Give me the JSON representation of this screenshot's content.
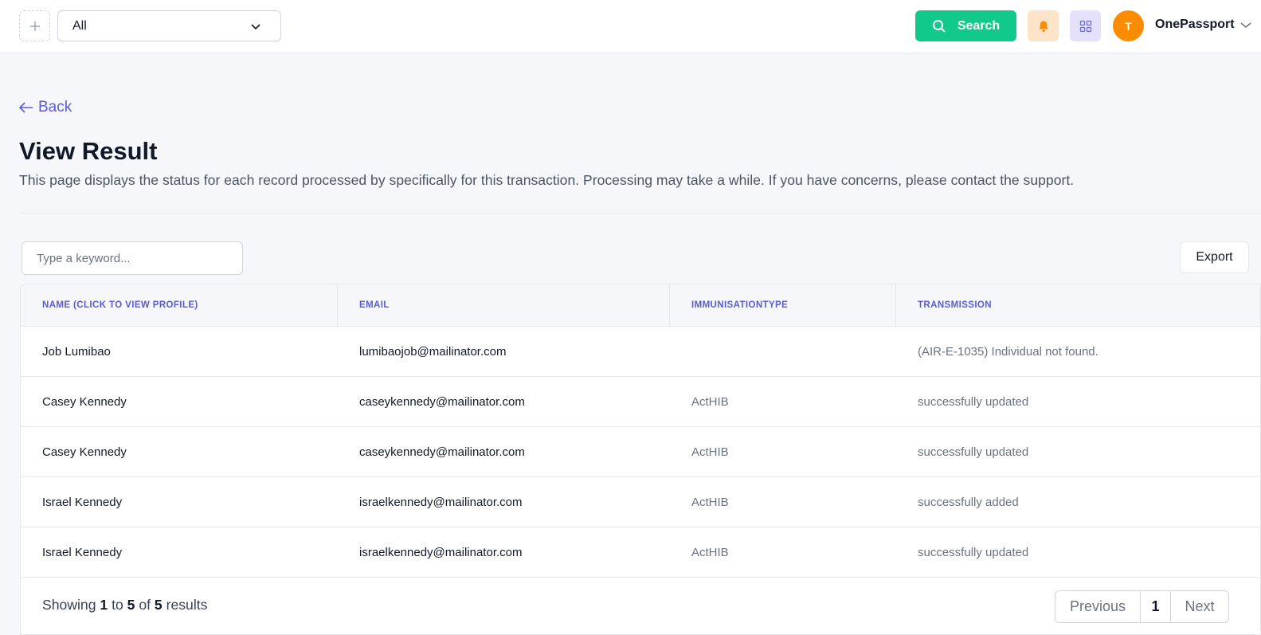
{
  "topbar": {
    "scope_value": "All",
    "search_label": "Search",
    "avatar_initial": "T",
    "user_name": "OnePassport"
  },
  "page": {
    "back_label": "Back",
    "title": "View Result",
    "description": "This page displays the status for each record processed by specifically for this transaction. Processing may take a while. If you have concerns, please contact the support."
  },
  "toolbar": {
    "keyword_placeholder": "Type a keyword...",
    "export_label": "Export"
  },
  "table": {
    "headers": [
      "NAME (CLICK TO VIEW PROFILE)",
      "EMAIL",
      "IMMUNISATIONTYPE",
      "TRANSMISSION"
    ],
    "rows": [
      [
        "Job Lumibao",
        "lumibaojob@mailinator.com",
        "",
        "(AIR-E-1035) Individual not found."
      ],
      [
        "Casey Kennedy",
        "caseykennedy@mailinator.com",
        "ActHIB",
        "successfully updated"
      ],
      [
        "Casey Kennedy",
        "caseykennedy@mailinator.com",
        "ActHIB",
        "successfully updated"
      ],
      [
        "Israel Kennedy",
        "israelkennedy@mailinator.com",
        "ActHIB",
        "successfully added"
      ],
      [
        "Israel Kennedy",
        "israelkennedy@mailinator.com",
        "ActHIB",
        "successfully updated"
      ]
    ]
  },
  "pagination": {
    "showing_prefix": "Showing",
    "from": "1",
    "to_word": "to",
    "to": "5",
    "of_word": "of",
    "total": "5",
    "results_word": "results",
    "previous_label": "Previous",
    "current_page": "1",
    "next_label": "Next"
  },
  "colors": {
    "accent": "#5b5bd6",
    "search_green": "#10c98a",
    "avatar_orange": "#fb8c00",
    "bell_bg": "#fde3c8",
    "grid_bg": "#e3e1fb"
  },
  "icons": {
    "plus": "plus-icon",
    "chevron": "chevron-down-icon",
    "search": "search-icon",
    "bell": "bell-icon",
    "grid": "grid-icon",
    "back_arrow": "arrow-left-icon"
  }
}
